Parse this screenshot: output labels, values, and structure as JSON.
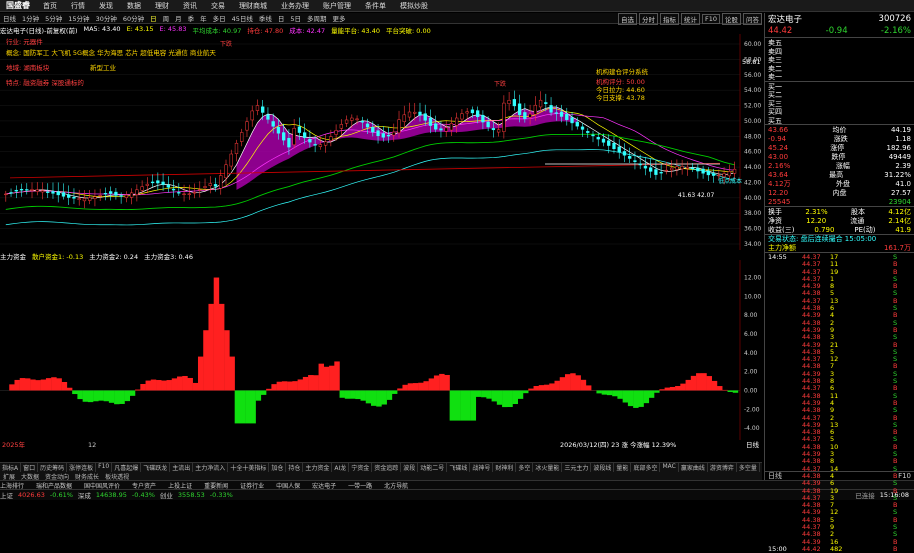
{
  "menubar": {
    "logo": "国盛睿",
    "items": [
      "首页",
      "行情",
      "发现",
      "数据",
      "理财",
      "资讯",
      "交易",
      "理财商城",
      "业务办理",
      "账户管理",
      "条件单",
      "模拟炒股"
    ]
  },
  "toolbar": {
    "items": [
      "日线",
      "1分钟",
      "5分钟",
      "15分钟",
      "30分钟",
      "60分钟",
      "日",
      "周",
      "月",
      "季",
      "年",
      "多日",
      "45日线",
      "季线",
      "日",
      "5日",
      "多周期",
      "更多"
    ],
    "selected": 6,
    "right": [
      "自选",
      "分时",
      "指标",
      "统计",
      "F10",
      "论股",
      "问答"
    ]
  },
  "info_line": {
    "title": "宏达电子(日线)-前复权(前)",
    "ma5": "MA5: 43.40",
    "ma10": "E: 43.15",
    "ma20": "E: 45.83",
    "avg": "平均成本: 40.97",
    "hold": "持仓: 47.80",
    "pos": "成本: 42.47",
    "board": "量能平台: 43.40",
    "plat": "平台突破: 0.00"
  },
  "annotations": {
    "a1": "概念: 国防军工 大飞机 5G概念 华为海思 芯片 超低电容 光通信 商业航天",
    "a2": "行业: 元器件",
    "a3": "地域: 湖南板块",
    "a4": "特点: 融资融券 深股通标的",
    "a5": "新型工业",
    "side1": "机构建仓评分系统",
    "side2": "机构评分: 50.00",
    "side3": "今日拉力: 44.60",
    "side4": "今日支撑: 43.78",
    "tag1": "下跌",
    "tag2": "下跌",
    "low1": "41.63 42.07",
    "right_tag": "低点成本"
  },
  "yaxis": {
    "main": [
      "60.00",
      "58.00",
      "56.00",
      "54.00",
      "52.00",
      "50.00",
      "48.00",
      "46.00",
      "44.00",
      "42.00",
      "40.00",
      "38.00",
      "36.00",
      "34.00"
    ],
    "ind": [
      "12.00",
      "10.00",
      "8.00",
      "6.00",
      "4.00",
      "2.00",
      "0.00",
      "-2.00",
      "-4.00"
    ],
    "topprice": "58.81"
  },
  "indicator": {
    "name": "主力资金",
    "v1": "散户资金1: -0.13",
    "v2": "主力资金2: 0.24",
    "v3": "主力资金3: 0.46",
    "bottom": "主力资金",
    "date": "2026/03/12(四) 23 涨 今涨幅 12.39%"
  },
  "xaxis": {
    "start": "2025年",
    "mid": "12",
    "end": "日线"
  },
  "bottom_tabs": [
    "指标A",
    "窗口",
    "历史筹码",
    "涨停连板",
    "F10",
    "凡喜起爆",
    "飞碟跃龙",
    "主流出",
    "主力净流入",
    "十全十美指标",
    "加仓",
    "持仓",
    "主力资金",
    "AI龙",
    "宁资金",
    "资金追踪",
    "波段",
    "动能二号",
    "飞碟线",
    "战神号",
    "财神利",
    "多空",
    "冰火量能",
    "三元主力",
    "波段线",
    "量能",
    "底部多空",
    "MAC",
    "赢家曲线",
    "游资博弈",
    "多空量",
    "短线强弱",
    "日线"
  ],
  "bottom_tabs2": [
    "扩展",
    "大数据",
    "资金动向",
    "财务成长",
    "板块透视"
  ],
  "ticker": [
    "上海排行",
    "瑞和产品数据",
    "国中国风评价",
    "专户资产",
    "上投上证",
    "重要新闻",
    "证券行业",
    "中国人保",
    "宏达电子",
    "一带一路",
    "北方导航"
  ],
  "status": {
    "sh": "上证",
    "sh_v": "4026.63",
    "sh_c": "-0.61%",
    "sz": "深成",
    "sz_v": "14638.95",
    "sz_c": "-0.43%",
    "cy": "创业",
    "cy_v": "3558.53",
    "cy_c": "-0.33%",
    "ex": "已连接",
    "time": "15:16:08"
  },
  "rpanel": {
    "name": "宏达电子",
    "code": "300726",
    "price": "44.42",
    "chg": "-0.94",
    "pct": "-2.16%",
    "asks": [
      [
        "卖五",
        "",
        ""
      ],
      [
        "卖四",
        "",
        ""
      ],
      [
        "卖三",
        "",
        ""
      ],
      [
        "卖二",
        "",
        ""
      ],
      [
        "卖一",
        "",
        ""
      ]
    ],
    "bids": [
      [
        "买一",
        "",
        ""
      ],
      [
        "买二",
        "",
        ""
      ],
      [
        "买三",
        "",
        ""
      ],
      [
        "买四",
        "",
        ""
      ],
      [
        "买五",
        "",
        ""
      ]
    ],
    "stats": [
      [
        "43.66",
        "均价",
        "44.19"
      ],
      [
        "-0.94",
        "涨跌",
        "1.18"
      ],
      [
        "45.24",
        "涨停",
        "182.96"
      ],
      [
        "43.00",
        "跌停",
        "49449"
      ],
      [
        "2.16%",
        "涨幅",
        "2.39"
      ],
      [
        "43.64",
        "最高",
        "31.22%"
      ],
      [
        "4.12万",
        "外盘",
        "41.0"
      ],
      [
        "12.20",
        "内盘",
        "27.57"
      ]
    ],
    "outer": "25545",
    "inner": "23904",
    "ex": [
      [
        "换手",
        "2.31%",
        "股本",
        "4.12亿"
      ],
      [
        "净资",
        "12.20",
        "流通",
        "2.14亿"
      ],
      [
        "收益(三)",
        "0.790",
        "PE(动)",
        "41.9"
      ]
    ],
    "state": "交易状态: 盘后连续撮合 15:05:00",
    "mainnet": "主力净额",
    "mainnet_v": "161.7万",
    "trades": [
      [
        "14:55",
        "44.37",
        "17",
        "S"
      ],
      [
        "",
        "44.37",
        "11",
        "B"
      ],
      [
        "",
        "44.37",
        "19",
        "B"
      ],
      [
        "",
        "44.37",
        "1",
        "S"
      ],
      [
        "",
        "44.39",
        "8",
        "B"
      ],
      [
        "",
        "44.38",
        "5",
        "S"
      ],
      [
        "",
        "44.37",
        "13",
        "B"
      ],
      [
        "",
        "44.38",
        "6",
        "S"
      ],
      [
        "",
        "44.39",
        "4",
        "B"
      ],
      [
        "",
        "44.38",
        "2",
        "S"
      ],
      [
        "",
        "44.39",
        "9",
        "B"
      ],
      [
        "",
        "44.38",
        "3",
        "S"
      ],
      [
        "",
        "44.39",
        "21",
        "B"
      ],
      [
        "",
        "44.38",
        "5",
        "S"
      ],
      [
        "",
        "44.37",
        "12",
        "S"
      ],
      [
        "",
        "44.38",
        "7",
        "B"
      ],
      [
        "",
        "44.39",
        "3",
        "S"
      ],
      [
        "",
        "44.38",
        "8",
        "S"
      ],
      [
        "",
        "44.37",
        "6",
        "B"
      ],
      [
        "",
        "44.38",
        "11",
        "S"
      ],
      [
        "",
        "44.39",
        "4",
        "B"
      ],
      [
        "",
        "44.38",
        "9",
        "S"
      ],
      [
        "",
        "44.37",
        "2",
        "B"
      ],
      [
        "",
        "44.39",
        "13",
        "S"
      ],
      [
        "",
        "44.38",
        "6",
        "B"
      ],
      [
        "",
        "44.37",
        "5",
        "S"
      ],
      [
        "",
        "44.38",
        "10",
        "B"
      ],
      [
        "",
        "44.39",
        "3",
        "S"
      ],
      [
        "",
        "44.38",
        "8",
        "B"
      ],
      [
        "",
        "44.37",
        "14",
        "S"
      ],
      [
        "",
        "44.38",
        "4",
        "B"
      ],
      [
        "",
        "44.39",
        "6",
        "S"
      ],
      [
        "",
        "44.38",
        "19",
        "B"
      ],
      [
        "",
        "44.37",
        "3",
        "S"
      ],
      [
        "",
        "44.38",
        "7",
        "B"
      ],
      [
        "",
        "44.39",
        "12",
        "S"
      ],
      [
        "",
        "44.38",
        "5",
        "B"
      ],
      [
        "",
        "44.37",
        "9",
        "S"
      ],
      [
        "",
        "44.38",
        "2",
        "S"
      ],
      [
        "",
        "44.39",
        "16",
        "B"
      ],
      [
        "15:00",
        "44.42",
        "482",
        "B"
      ]
    ],
    "tabs": [
      "日线",
      "F10"
    ]
  }
}
